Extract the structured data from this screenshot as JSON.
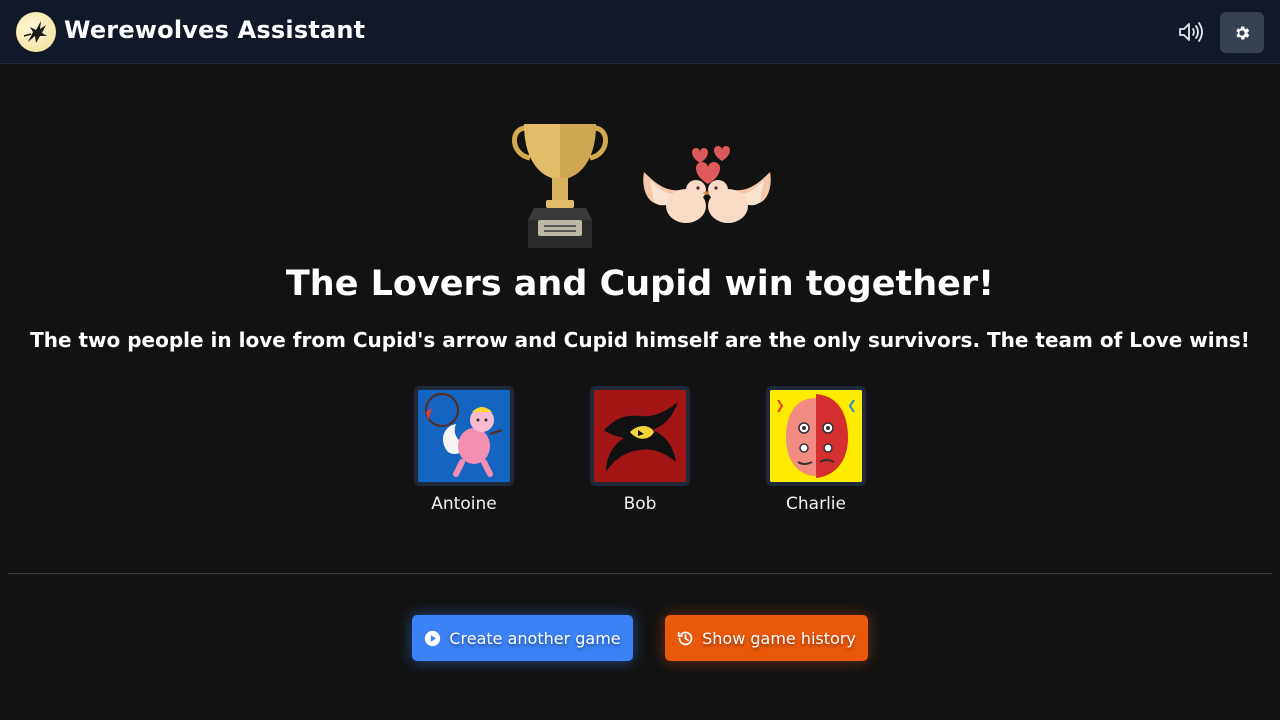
{
  "app": {
    "title": "Werewolves Assistant"
  },
  "header": {
    "sound_icon": "volume-icon",
    "settings_icon": "gear-icon"
  },
  "result": {
    "headline": "The Lovers and Cupid win together!",
    "description": "The two people in love from Cupid's arrow and Cupid himself are the only survivors. The team of Love wins!"
  },
  "players": [
    {
      "name": "Antoine",
      "role_icon": "cupid-icon"
    },
    {
      "name": "Bob",
      "role_icon": "werewolf-icon"
    },
    {
      "name": "Charlie",
      "role_icon": "two-faced-icon"
    }
  ],
  "actions": {
    "create_label": "Create another game",
    "history_label": "Show game history"
  },
  "colors": {
    "primary": "#3b82f6",
    "warning": "#ea580c",
    "background": "#121212",
    "header": "#111827"
  }
}
